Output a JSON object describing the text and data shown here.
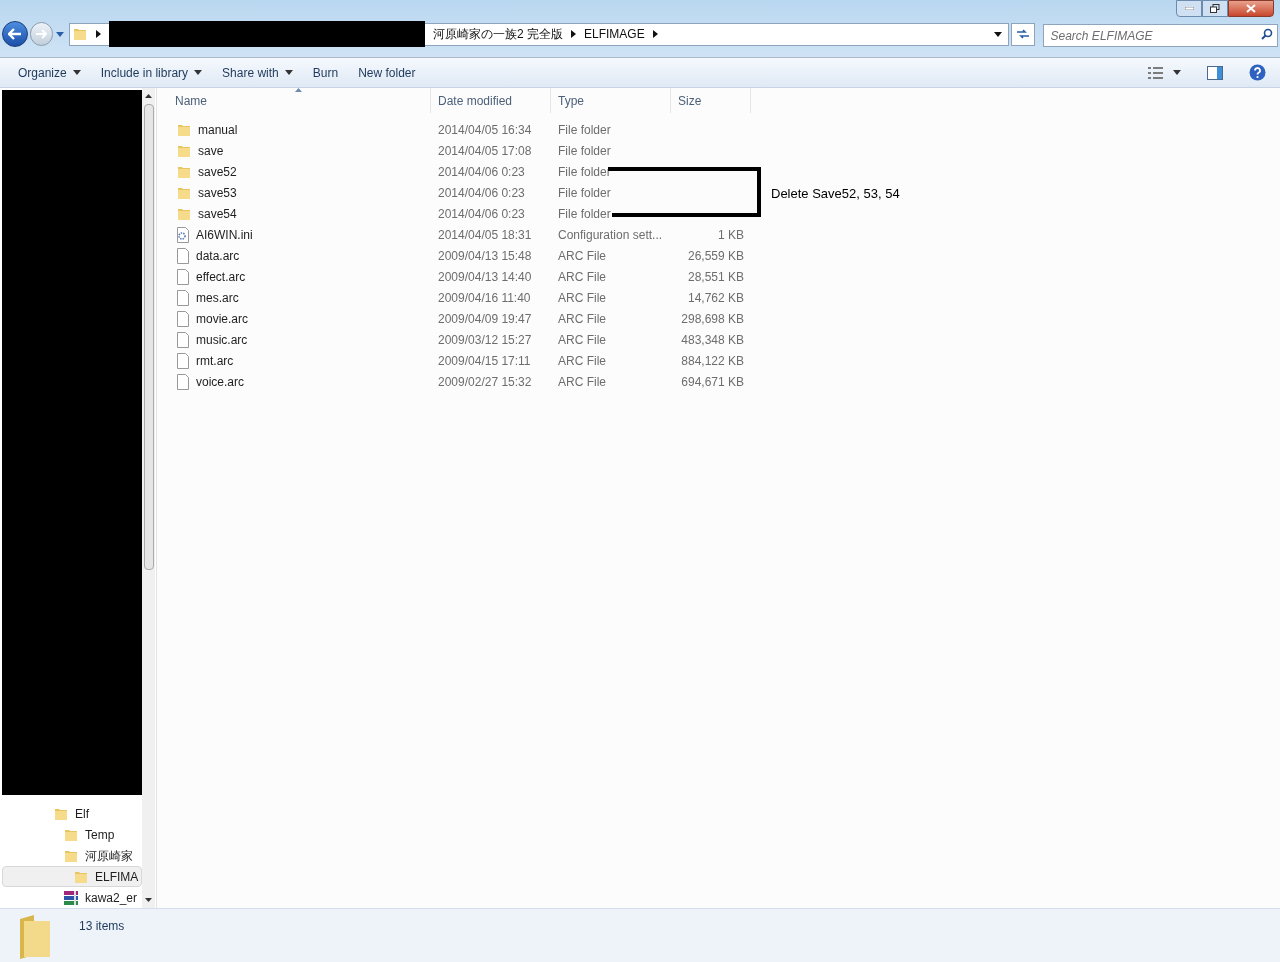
{
  "address_bar": {
    "breadcrumbs": [
      "河原崎家の一族2 完全版",
      "ELFIMAGE"
    ]
  },
  "search": {
    "placeholder": "Search ELFIMAGE"
  },
  "toolbar": {
    "buttons": [
      {
        "label": "Organize",
        "dropdown": true
      },
      {
        "label": "Include in library",
        "dropdown": true
      },
      {
        "label": "Share with",
        "dropdown": true
      },
      {
        "label": "Burn",
        "dropdown": false
      },
      {
        "label": "New folder",
        "dropdown": false
      }
    ]
  },
  "nav_tree": [
    {
      "label": "Elf",
      "kind": "folder",
      "selected": false,
      "children": [
        {
          "label": "Temp",
          "kind": "folder",
          "selected": false
        },
        {
          "label": "河原崎家",
          "kind": "folder",
          "selected": false,
          "children": [
            {
              "label": "ELFIMA",
              "kind": "folder",
              "selected": true
            }
          ]
        },
        {
          "label": "kawa2_er",
          "kind": "archive",
          "selected": false
        }
      ]
    }
  ],
  "table": {
    "columns": [
      "Name",
      "Date modified",
      "Type",
      "Size"
    ],
    "rows": [
      {
        "name": "manual",
        "date": "2014/04/05 16:34",
        "type": "File folder",
        "kind": "folder"
      },
      {
        "name": "save",
        "date": "2014/04/05 17:08",
        "type": "File folder",
        "kind": "folder"
      },
      {
        "name": "save52",
        "date": "2014/04/06 0:23",
        "type": "File folder",
        "kind": "folder"
      },
      {
        "name": "save53",
        "date": "2014/04/06 0:23",
        "type": "File folder",
        "kind": "folder"
      },
      {
        "name": "save54",
        "date": "2014/04/06 0:23",
        "type": "File folder",
        "kind": "folder"
      },
      {
        "name": "AI6WIN.ini",
        "date": "2014/04/05 18:31",
        "type": "Configuration sett...",
        "size": "1 KB",
        "kind": "settings"
      },
      {
        "name": "data.arc",
        "date": "2009/04/13 15:48",
        "type": "ARC File",
        "size": "26,559 KB",
        "kind": "file"
      },
      {
        "name": "effect.arc",
        "date": "2009/04/13 14:40",
        "type": "ARC File",
        "size": "28,551 KB",
        "kind": "file"
      },
      {
        "name": "mes.arc",
        "date": "2009/04/16 11:40",
        "type": "ARC File",
        "size": "14,762 KB",
        "kind": "file"
      },
      {
        "name": "movie.arc",
        "date": "2009/04/09 19:47",
        "type": "ARC File",
        "size": "298,698 KB",
        "kind": "file"
      },
      {
        "name": "music.arc",
        "date": "2009/03/12 15:27",
        "type": "ARC File",
        "size": "483,348 KB",
        "kind": "file"
      },
      {
        "name": "rmt.arc",
        "date": "2009/04/15 17:11",
        "type": "ARC File",
        "size": "884,122 KB",
        "kind": "file"
      },
      {
        "name": "voice.arc",
        "date": "2009/02/27 15:32",
        "type": "ARC File",
        "size": "694,671 KB",
        "kind": "file"
      }
    ]
  },
  "annotation": {
    "text": "Delete Save52, 53, 54"
  },
  "status_bar": {
    "count": "13 items"
  }
}
